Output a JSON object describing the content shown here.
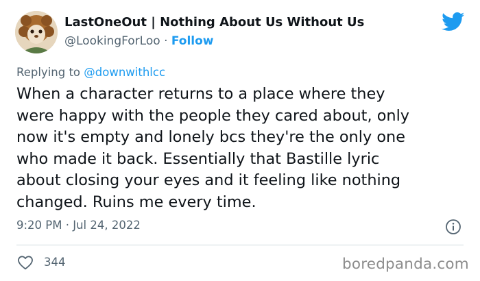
{
  "author": {
    "display_name": "LastOneOut | Nothing About Us Without Us",
    "handle": "@LookingForLoo",
    "separator": "·",
    "follow_label": "Follow"
  },
  "reply": {
    "prefix": "Replying to",
    "mention": "@downwithlcc"
  },
  "tweet": {
    "lines": [
      "When a character returns to a place where they",
      "were happy with the people they cared about, only",
      "now it's empty and lonely bcs they're the only one",
      "who made it back. Essentially that Bastille lyric",
      "about closing your eyes and it feeling like nothing",
      "changed. Ruins me every time."
    ],
    "timestamp": "9:20 PM · Jul 24, 2022"
  },
  "engagement": {
    "likes": "344"
  },
  "watermark": "boredpanda.com",
  "icons": {
    "brand": "twitter-bird-icon",
    "info": "info-icon",
    "like": "heart-icon"
  },
  "colors": {
    "twitter_blue": "#1d9bf0",
    "secondary_text": "#536471",
    "primary_text": "#0f1419",
    "divider": "#cfd9de"
  }
}
